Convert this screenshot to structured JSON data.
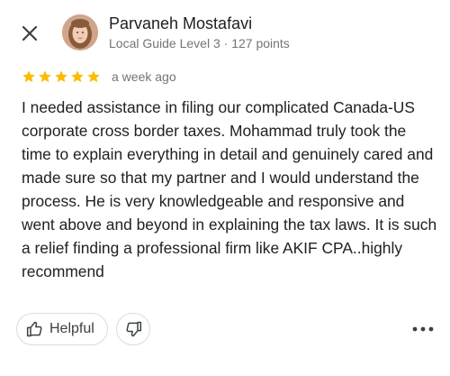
{
  "header": {
    "close_icon": "close-icon"
  },
  "author": {
    "name": "Parvaneh Mostafavi",
    "meta": "Local Guide Level 3 · 127 points",
    "avatar_icon": "avatar"
  },
  "rating": {
    "stars": 5,
    "max_stars": 5,
    "time": "a week ago",
    "star_color": "#fbbc04"
  },
  "review": {
    "text": "I needed assistance in filing our complicated Canada-US corporate cross border taxes. Mohammad truly took the time to explain everything in detail and genuinely cared and made sure so that my partner and I would understand the process. He is very knowledgeable and responsive and went above and beyond in explaining the tax laws. It is such a relief finding a professional firm like AKIF CPA..highly recommend"
  },
  "actions": {
    "helpful_label": "Helpful",
    "helpful_icon": "thumbs-up-icon",
    "dislike_icon": "thumbs-down-icon",
    "more_icon": "more-horizontal-icon"
  }
}
